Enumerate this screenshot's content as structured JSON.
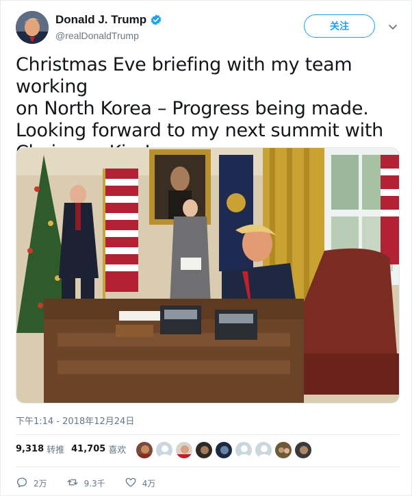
{
  "author": {
    "display_name": "Donald J. Trump",
    "handle": "@realDonaldTrump",
    "verified": true
  },
  "follow_button_label": "关注",
  "tweet": {
    "line1": "Christmas Eve briefing with my team working",
    "line2": "on North Korea – Progress being made.",
    "line3": "Looking forward to my next summit with",
    "line4": "Chairman Kim!"
  },
  "timestamp": "下午1:14 - 2018年12月24日",
  "stats": {
    "retweets_count": "9,318",
    "retweets_label": "转推",
    "likes_count": "41,705",
    "likes_label": "喜欢"
  },
  "actions": {
    "replies": "2万",
    "retweets": "9.3千",
    "likes": "4万"
  },
  "colors": {
    "accent": "#1da1f2",
    "text": "#14171a",
    "muted": "#657786",
    "divider": "#e6ecf0"
  },
  "icons": [
    "verified-badge-icon",
    "chevron-down-icon",
    "reply-icon",
    "retweet-icon",
    "heart-icon"
  ]
}
